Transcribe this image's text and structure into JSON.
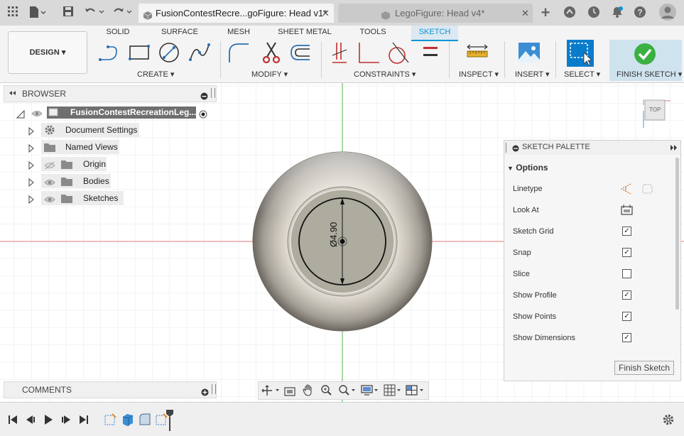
{
  "titlebar": {
    "tabs": [
      {
        "label": "FusionContestRecre...goFigure: Head v1*",
        "active": true
      },
      {
        "label": "LegoFigure: Head v4*",
        "active": false
      }
    ],
    "close_glyph": "✕",
    "add_tab_glyph": "+"
  },
  "toolbar": {
    "workspace_tabs": [
      "SOLID",
      "SURFACE",
      "MESH",
      "SHEET METAL",
      "TOOLS",
      "SKETCH"
    ],
    "active_tab": "SKETCH",
    "design_label": "DESIGN ▾",
    "groups": {
      "create": "CREATE ▾",
      "modify": "MODIFY ▾",
      "constraints": "CONSTRAINTS ▾",
      "inspect": "INSPECT ▾",
      "insert": "INSERT ▾",
      "select": "SELECT ▾",
      "finish": "FINISH SKETCH ▾"
    }
  },
  "browser": {
    "title": "BROWSER",
    "root": "FusionContestRecreationLeg...",
    "items": [
      "Document Settings",
      "Named Views",
      "Origin",
      "Bodies",
      "Sketches"
    ]
  },
  "comments": {
    "title": "COMMENTS"
  },
  "viewcube": {
    "label": "TOP"
  },
  "sketch": {
    "dimension": "Ø4.90"
  },
  "palette": {
    "title": "SKETCH PALETTE",
    "section": "Options",
    "rows": [
      {
        "label": "Linetype"
      },
      {
        "label": "Look At"
      },
      {
        "label": "Sketch Grid",
        "checked": true,
        "mark": "✓"
      },
      {
        "label": "Snap",
        "checked": true,
        "mark": "✓"
      },
      {
        "label": "Slice",
        "checked": false,
        "mark": ""
      },
      {
        "label": "Show Profile",
        "checked": true,
        "mark": "✓"
      },
      {
        "label": "Show Points",
        "checked": true,
        "mark": "✓"
      },
      {
        "label": "Show Dimensions",
        "checked": true,
        "mark": "✓"
      }
    ],
    "finish_button": "Finish Sketch"
  },
  "colors": {
    "accent": "#0696d7",
    "finish_green": "#3cb043",
    "x_axis": "#e06060",
    "y_axis": "#5cb85c"
  }
}
